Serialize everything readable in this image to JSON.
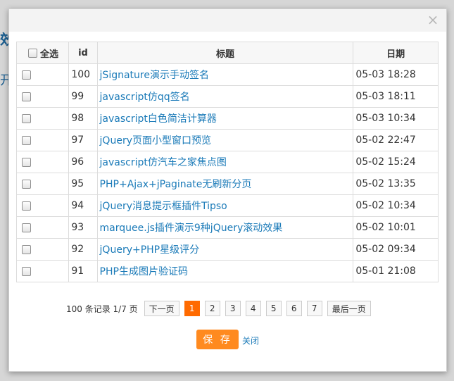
{
  "background": {
    "title_fragment": "效程",
    "sub_fragment": "开"
  },
  "dialog": {
    "close_glyph": "×"
  },
  "table": {
    "headers": {
      "select_all": "全选",
      "id": "id",
      "title": "标题",
      "date": "日期"
    },
    "rows": [
      {
        "id": "100",
        "title": "jSignature演示手动签名",
        "date": "05-03 18:28"
      },
      {
        "id": "99",
        "title": "javascript仿qq签名",
        "date": "05-03 18:11"
      },
      {
        "id": "98",
        "title": "javascript白色简洁计算器",
        "date": "05-03 10:34"
      },
      {
        "id": "97",
        "title": "jQuery页面小型窗口预览",
        "date": "05-02 22:47"
      },
      {
        "id": "96",
        "title": "javascript仿汽车之家焦点图",
        "date": "05-02 15:24"
      },
      {
        "id": "95",
        "title": "PHP+Ajax+jPaginate无刷新分页",
        "date": "05-02 13:35"
      },
      {
        "id": "94",
        "title": "jQuery消息提示框插件Tipso",
        "date": "05-02 10:34"
      },
      {
        "id": "93",
        "title": "marquee.js插件演示9种jQuery滚动效果",
        "date": "05-02 10:01"
      },
      {
        "id": "92",
        "title": "jQuery+PHP星级评分",
        "date": "05-02 09:34"
      },
      {
        "id": "91",
        "title": "PHP生成图片验证码",
        "date": "05-01 21:08"
      }
    ]
  },
  "pager": {
    "info": "100 条记录 1/7 页",
    "next": "下一页",
    "pages": [
      "1",
      "2",
      "3",
      "4",
      "5",
      "6",
      "7"
    ],
    "current": "1",
    "last": "最后一页"
  },
  "actions": {
    "save": "保 存",
    "close": "关闭"
  },
  "colors": {
    "accent": "#ff6a00",
    "save": "#ff8a1f",
    "link": "#1a7ab8"
  }
}
